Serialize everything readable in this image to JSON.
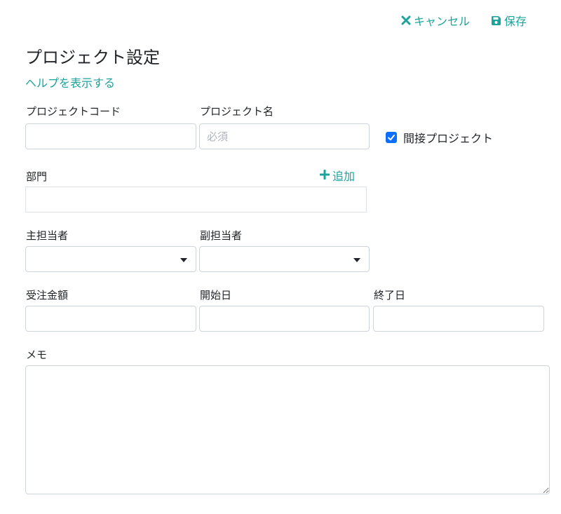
{
  "toolbar": {
    "cancel_label": "キャンセル",
    "save_label": "保存"
  },
  "page": {
    "title": "プロジェクト設定",
    "help_link": "ヘルプを表示する"
  },
  "form": {
    "project_code": {
      "label": "プロジェクトコード",
      "value": ""
    },
    "project_name": {
      "label": "プロジェクト名",
      "placeholder": "必須",
      "value": ""
    },
    "indirect_project": {
      "label": "間接プロジェクト",
      "checked": true
    },
    "department": {
      "label": "部門",
      "add_label": "追加",
      "value": ""
    },
    "main_owner": {
      "label": "主担当者",
      "value": ""
    },
    "sub_owner": {
      "label": "副担当者",
      "value": ""
    },
    "order_amount": {
      "label": "受注金額",
      "value": ""
    },
    "start_date": {
      "label": "開始日",
      "value": ""
    },
    "end_date": {
      "label": "終了日",
      "value": ""
    },
    "memo": {
      "label": "メモ",
      "value": ""
    }
  },
  "colors": {
    "accent": "#1ba39c",
    "checkbox": "#0d6efd",
    "border": "#ced4da"
  }
}
